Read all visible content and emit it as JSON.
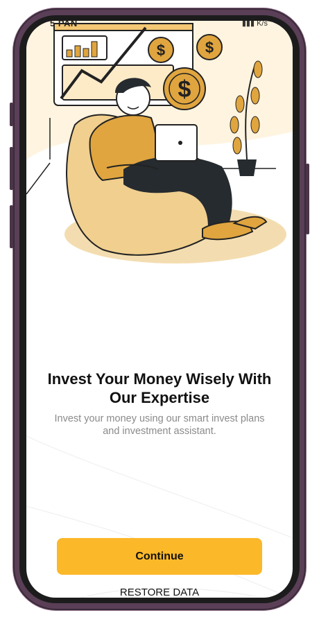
{
  "status_bar": {
    "left_text": "5 PAN",
    "right_text": "K/s"
  },
  "illustration": {
    "coin_symbol": "$",
    "colors": {
      "accent": "#fbb829",
      "coin": "#e0a53f",
      "dark": "#262b2f",
      "cream": "#fff4e0"
    }
  },
  "onboarding": {
    "title": "Invest Your Money Wisely With Our Expertise",
    "subtitle": "Invest your money using our smart invest plans and investment assistant."
  },
  "actions": {
    "continue_label": "Continue",
    "restore_label": "RESTORE DATA"
  }
}
